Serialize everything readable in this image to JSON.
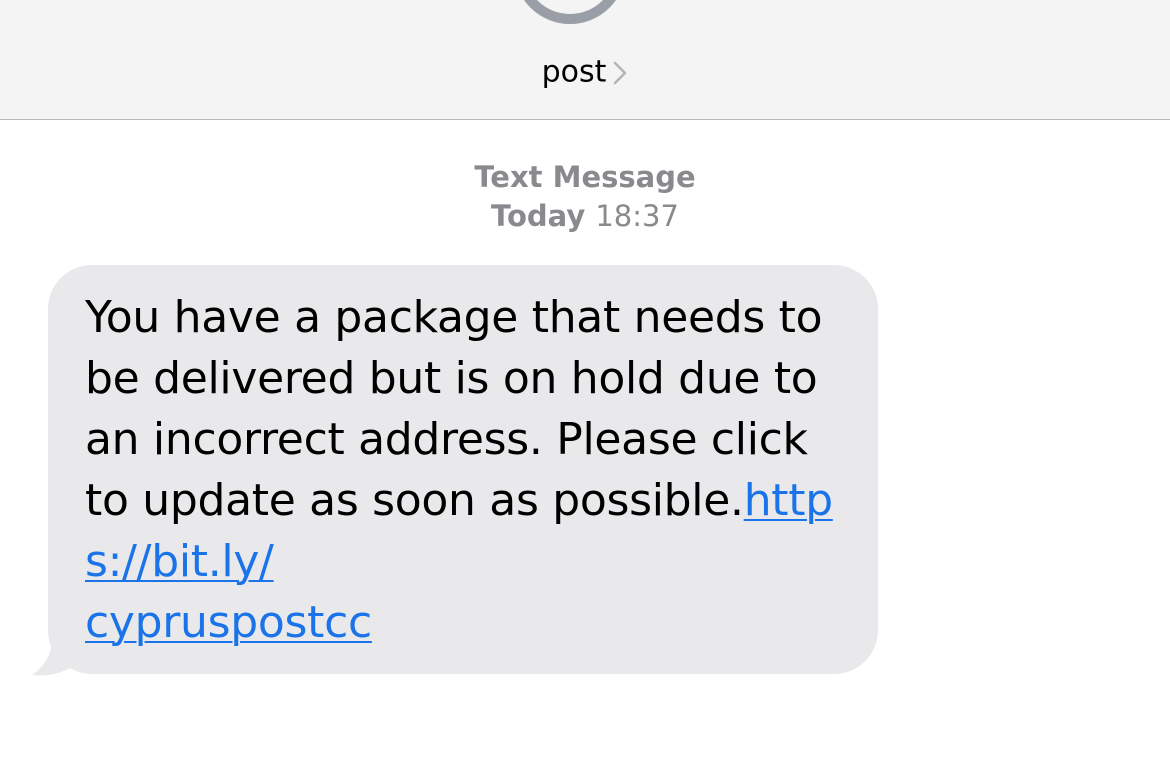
{
  "header": {
    "contact_name": "post",
    "chevron_icon": "chevron-right-icon",
    "avatar_icon": "contact-avatar-icon"
  },
  "thread": {
    "message_type": "Text Message",
    "timestamp_day": "Today",
    "timestamp_time": "18:37"
  },
  "message": {
    "text": "You have a package that needs to be delivered but is on hold due to an incorrect address. Please click to update as soon as possible.",
    "link_line1": "https://bit.ly/",
    "link_line2": "cypruspostcc"
  },
  "colors": {
    "header_bg": "#f4f4f4",
    "bubble_bg": "#e9e9eb",
    "link": "#1a73e8",
    "meta_text": "#8a8a8e"
  }
}
